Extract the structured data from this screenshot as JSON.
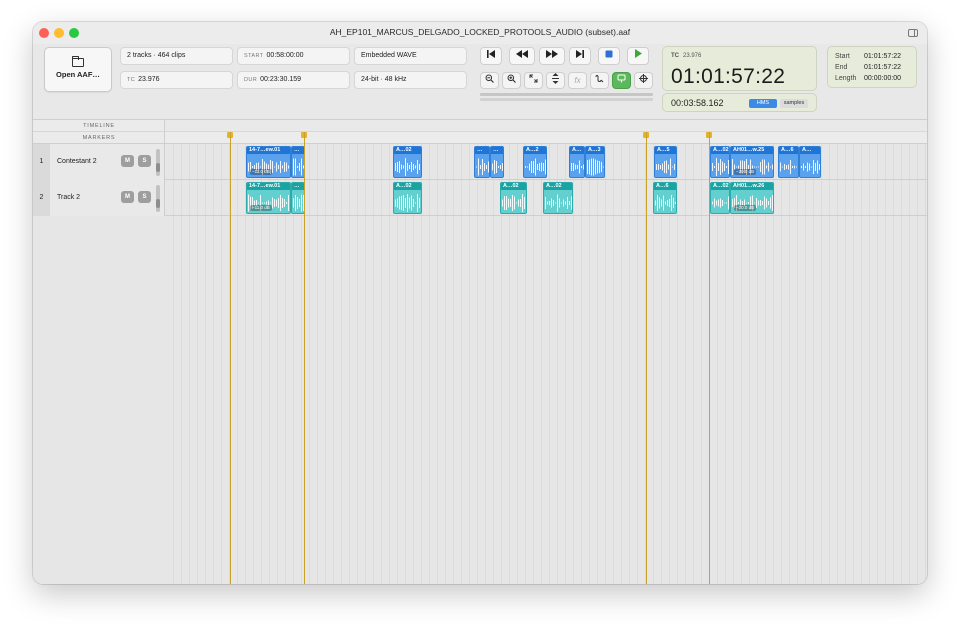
{
  "window": {
    "title": "AH_EP101_MARCUS_DELGADO_LOCKED_PROTOOLS_AUDIO (subset).aaf"
  },
  "toolbar": {
    "open_label": "Open AAF…",
    "info": {
      "tracks_clips": "2 tracks · 464 clips",
      "tc_key": "TC",
      "tc_rate": "23.976",
      "start_key": "START",
      "start_value": "00:58:00:00",
      "dur_key": "DUR",
      "dur_value": "00:23:30.159",
      "media": "Embedded WAVE",
      "format": "24-bit · 48 kHz"
    },
    "transport_icons": [
      "skip-to-start-icon",
      "rewind-icon",
      "fast-forward-icon",
      "skip-to-end-icon",
      "stop-icon",
      "play-icon"
    ],
    "tool_icons": [
      "zoom-out-icon",
      "zoom-in-icon",
      "zoom-fit-icon",
      "vertical-zoom-icon",
      "fx-icon",
      "link-icon",
      "snap-icon",
      "crosshair-icon"
    ],
    "fx_label": "fx"
  },
  "timecode": {
    "label": "TC",
    "rate": "23.976",
    "value": "01:01:57:22",
    "position": "00:03:58.162",
    "mode_hms": "HMS",
    "mode_samples": "samples"
  },
  "selection": {
    "start_label": "Start",
    "start_value": "01:01:57:22",
    "end_label": "End",
    "end_value": "01:01:57:22",
    "length_label": "Length",
    "length_value": "00:00:00:00"
  },
  "timeline": {
    "header_timeline": "TIMELINE",
    "header_markers": "MARKERS"
  },
  "tracks": [
    {
      "number": "1",
      "name": "Contestant 2",
      "mute": "M",
      "solo": "S",
      "clips": [
        {
          "label": "14-7…ew.01",
          "gain": "−11.0 dB"
        },
        {
          "label": "…",
          "gain": ""
        },
        {
          "label": "A…02",
          "gain": ""
        },
        {
          "label": "…",
          "gain": ""
        },
        {
          "label": "…",
          "gain": ""
        },
        {
          "label": "A…2",
          "gain": ""
        },
        {
          "label": "A…",
          "gain": ""
        },
        {
          "label": "A…3",
          "gain": ""
        },
        {
          "label": "A…5",
          "gain": ""
        },
        {
          "label": "A…02",
          "gain": ""
        },
        {
          "label": "AH01…w.25",
          "gain": "−20.0 dB"
        },
        {
          "label": "A…6",
          "gain": ""
        },
        {
          "label": "A…",
          "gain": ""
        }
      ]
    },
    {
      "number": "2",
      "name": "Track 2",
      "mute": "M",
      "solo": "S",
      "clips": [
        {
          "label": "14-7…ew.01",
          "gain": "−11.0 dB"
        },
        {
          "label": "…",
          "gain": ""
        },
        {
          "label": "A…02",
          "gain": ""
        },
        {
          "label": "A…02",
          "gain": ""
        },
        {
          "label": "A…02",
          "gain": ""
        },
        {
          "label": "A…6",
          "gain": ""
        },
        {
          "label": "A…02",
          "gain": ""
        },
        {
          "label": "AH01…w.26",
          "gain": "−20.0 dB"
        }
      ]
    }
  ],
  "colors": {
    "track1_clip": "#5aa2ee",
    "track2_clip": "#63cfcf",
    "marker": "#e3b32e",
    "timecode_panel": "#e6ecd9",
    "accent_blue": "#3d8ae6",
    "play_green": "#3aaa3a"
  }
}
